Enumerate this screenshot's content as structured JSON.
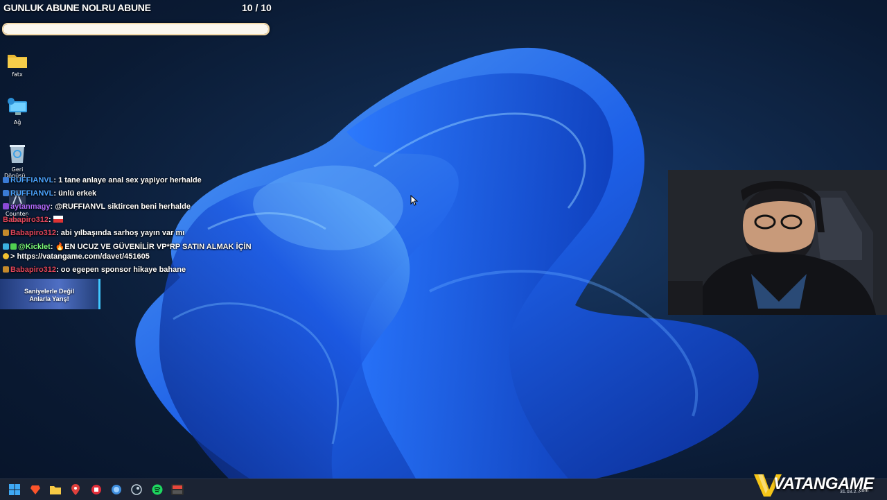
{
  "goal": {
    "title": "GUNLUK ABUNE NOLRU ABUNE",
    "count": "10 / 10",
    "progress_fraction": 1.0
  },
  "desktop_icons": [
    {
      "label": "fatx",
      "icon": "folder-icon"
    },
    {
      "label": "Ağ",
      "icon": "network-icon"
    },
    {
      "label": "Geri Dönüşü...",
      "icon": "recycle-bin-icon"
    },
    {
      "label": "Counter-Str...",
      "icon": "game-shortcut-icon"
    }
  ],
  "chat": {
    "messages": [
      {
        "user": "RUFFIANVL",
        "user_color": "#4aa3ff",
        "text": "1 tane anlaye anal sex yapiyor herhalde"
      },
      {
        "user": "RUFFIANVL",
        "user_color": "#4aa3ff",
        "text": "ünlü erkek"
      },
      {
        "user": "aytanmagy",
        "user_color": "#b36bff",
        "text": "@RUFFIANVL siktircen beni herhalde"
      },
      {
        "user": "Babapiro312",
        "user_color": "#e0455a",
        "text": ""
      },
      {
        "user": "Babapiro312",
        "user_color": "#e0455a",
        "text": "abi yılbaşında sarhoş yayın var mı"
      },
      {
        "user": "@Kicklet",
        "user_color": "#7dff7a",
        "text": "🔥EN UCUZ VE GÜVENİLİR VP*RP SATIN ALMAK İÇİN"
      },
      {
        "user": "",
        "user_color": "#ffffff",
        "text": "> https://vatangame.com/davet/451605"
      },
      {
        "user": "Babapiro312",
        "user_color": "#e0455a",
        "text": "oo egepen sponsor hikaye bahane"
      }
    ]
  },
  "ad_banner": {
    "line1": "Saniyelerle Değil",
    "line2": "Anlarla Yarış!"
  },
  "taskbar": {
    "items": [
      "start-icon",
      "brave-icon",
      "file-explorer-icon",
      "maps-pin-icon",
      "app-red-icon",
      "app-globe-icon",
      "steam-icon",
      "spotify-icon",
      "app-streamer-icon"
    ]
  },
  "logo": {
    "brand": "VATANGAME",
    "suffix": ".com"
  },
  "clock": {
    "date": "31.03.2..."
  },
  "colors": {
    "taskbar": "#1b2333",
    "accent_blue": "#1f6bff",
    "goal_border": "#f3d9a8"
  }
}
